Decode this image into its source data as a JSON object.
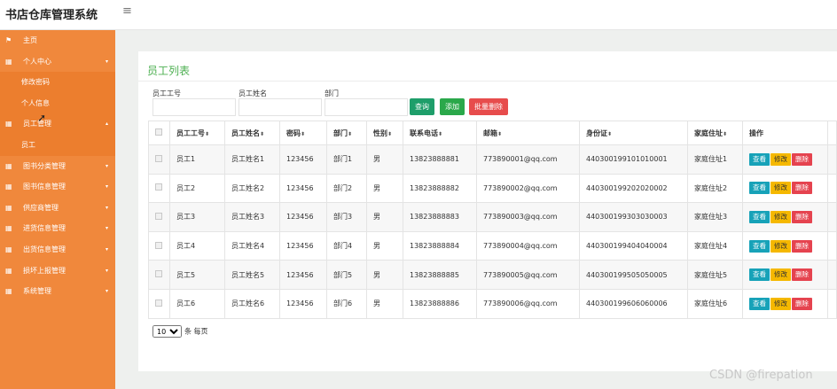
{
  "app": {
    "title": "书店仓库管理系统",
    "menu_toggle": "≡"
  },
  "sidebar": {
    "items": [
      {
        "label": "主页",
        "icon": "⚑",
        "type": "parent",
        "caret": ""
      },
      {
        "label": "个人中心",
        "icon": "▦",
        "type": "parent",
        "caret": "▾"
      },
      {
        "label": "修改密码",
        "icon": "",
        "type": "sub",
        "caret": ""
      },
      {
        "label": "个人信息",
        "icon": "",
        "type": "sub",
        "caret": ""
      },
      {
        "label": "员工管理",
        "icon": "▦",
        "type": "open",
        "caret": "▴"
      },
      {
        "label": "员工",
        "icon": "",
        "type": "sub",
        "caret": ""
      },
      {
        "label": "图书分类管理",
        "icon": "▦",
        "type": "parent",
        "caret": "▾"
      },
      {
        "label": "图书信息管理",
        "icon": "▦",
        "type": "parent",
        "caret": "▾"
      },
      {
        "label": "供应商管理",
        "icon": "▦",
        "type": "parent",
        "caret": "▾"
      },
      {
        "label": "进货信息管理",
        "icon": "▦",
        "type": "parent",
        "caret": "▾"
      },
      {
        "label": "出货信息管理",
        "icon": "▦",
        "type": "parent",
        "caret": "▾"
      },
      {
        "label": "损坏上报管理",
        "icon": "▦",
        "type": "parent",
        "caret": "▾"
      },
      {
        "label": "系统管理",
        "icon": "▦",
        "type": "parent",
        "caret": "▾"
      }
    ]
  },
  "panel": {
    "title": "员工列表"
  },
  "filters": {
    "employee_id_label": "员工工号",
    "employee_name_label": "员工姓名",
    "department_label": "部门",
    "employee_id_value": "",
    "employee_name_value": "",
    "department_value": ""
  },
  "buttons": {
    "query": "查询",
    "add": "添加",
    "batch_delete": "批量删除"
  },
  "table": {
    "headers": [
      "员工工号",
      "员工姓名",
      "密码",
      "部门",
      "性别",
      "联系电话",
      "邮箱",
      "身份证",
      "家庭住址",
      "操作"
    ],
    "sort_icon": "⬍",
    "actions": {
      "view": "查看",
      "edit": "修改",
      "delete": "删除"
    },
    "rows": [
      [
        "员工1",
        "员工姓名1",
        "123456",
        "部门1",
        "男",
        "13823888881",
        "773890001@qq.com",
        "440300199101010001",
        "家庭住址1"
      ],
      [
        "员工2",
        "员工姓名2",
        "123456",
        "部门2",
        "男",
        "13823888882",
        "773890002@qq.com",
        "440300199202020002",
        "家庭住址2"
      ],
      [
        "员工3",
        "员工姓名3",
        "123456",
        "部门3",
        "男",
        "13823888883",
        "773890003@qq.com",
        "440300199303030003",
        "家庭住址3"
      ],
      [
        "员工4",
        "员工姓名4",
        "123456",
        "部门4",
        "男",
        "13823888884",
        "773890004@qq.com",
        "440300199404040004",
        "家庭住址4"
      ],
      [
        "员工5",
        "员工姓名5",
        "123456",
        "部门5",
        "男",
        "13823888885",
        "773890005@qq.com",
        "440300199505050005",
        "家庭住址5"
      ],
      [
        "员工6",
        "员工姓名6",
        "123456",
        "部门6",
        "男",
        "13823888886",
        "773890006@qq.com",
        "440300199606060006",
        "家庭住址6"
      ]
    ]
  },
  "pager": {
    "page_size": "10",
    "per_page_label": "条 每页"
  },
  "watermark": "CSDN @firepation",
  "colors": {
    "sidebar": "#f0883c",
    "title_green": "#4caf50",
    "view": "#17a2b8",
    "edit": "#f5b800",
    "delete": "#e5434f"
  }
}
